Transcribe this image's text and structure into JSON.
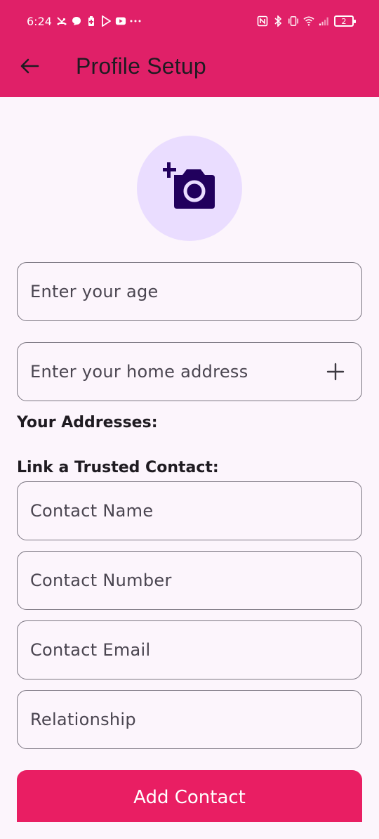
{
  "status_bar": {
    "time": "6:24",
    "battery_level": "2",
    "left_icons": [
      "missed-call-icon",
      "chat-bubble-icon",
      "battery-saver-icon",
      "play-store-icon",
      "youtube-icon",
      "more-dots-icon"
    ],
    "right_icons": [
      "nfc-icon",
      "bluetooth-icon",
      "vibrate-icon",
      "wifi-icon",
      "signal-icon",
      "battery-icon"
    ]
  },
  "app_bar": {
    "title": "Profile Setup",
    "back_icon": "arrow-back-icon",
    "background_color": "#e02068"
  },
  "avatar": {
    "icon": "add-a-photo-icon",
    "background_color": "#eaddff",
    "icon_color": "#21005d"
  },
  "form": {
    "age_placeholder": "Enter your age",
    "address_placeholder": "Enter your home address",
    "address_add_icon": "plus-icon",
    "addresses_heading": "Your Addresses:",
    "trusted_contact_heading": "Link a Trusted Contact:",
    "contact_name_placeholder": "Contact Name",
    "contact_number_placeholder": "Contact Number",
    "contact_email_placeholder": "Contact Email",
    "relationship_placeholder": "Relationship"
  },
  "actions": {
    "add_contact_label": "Add Contact",
    "button_color": "#e91e63"
  }
}
